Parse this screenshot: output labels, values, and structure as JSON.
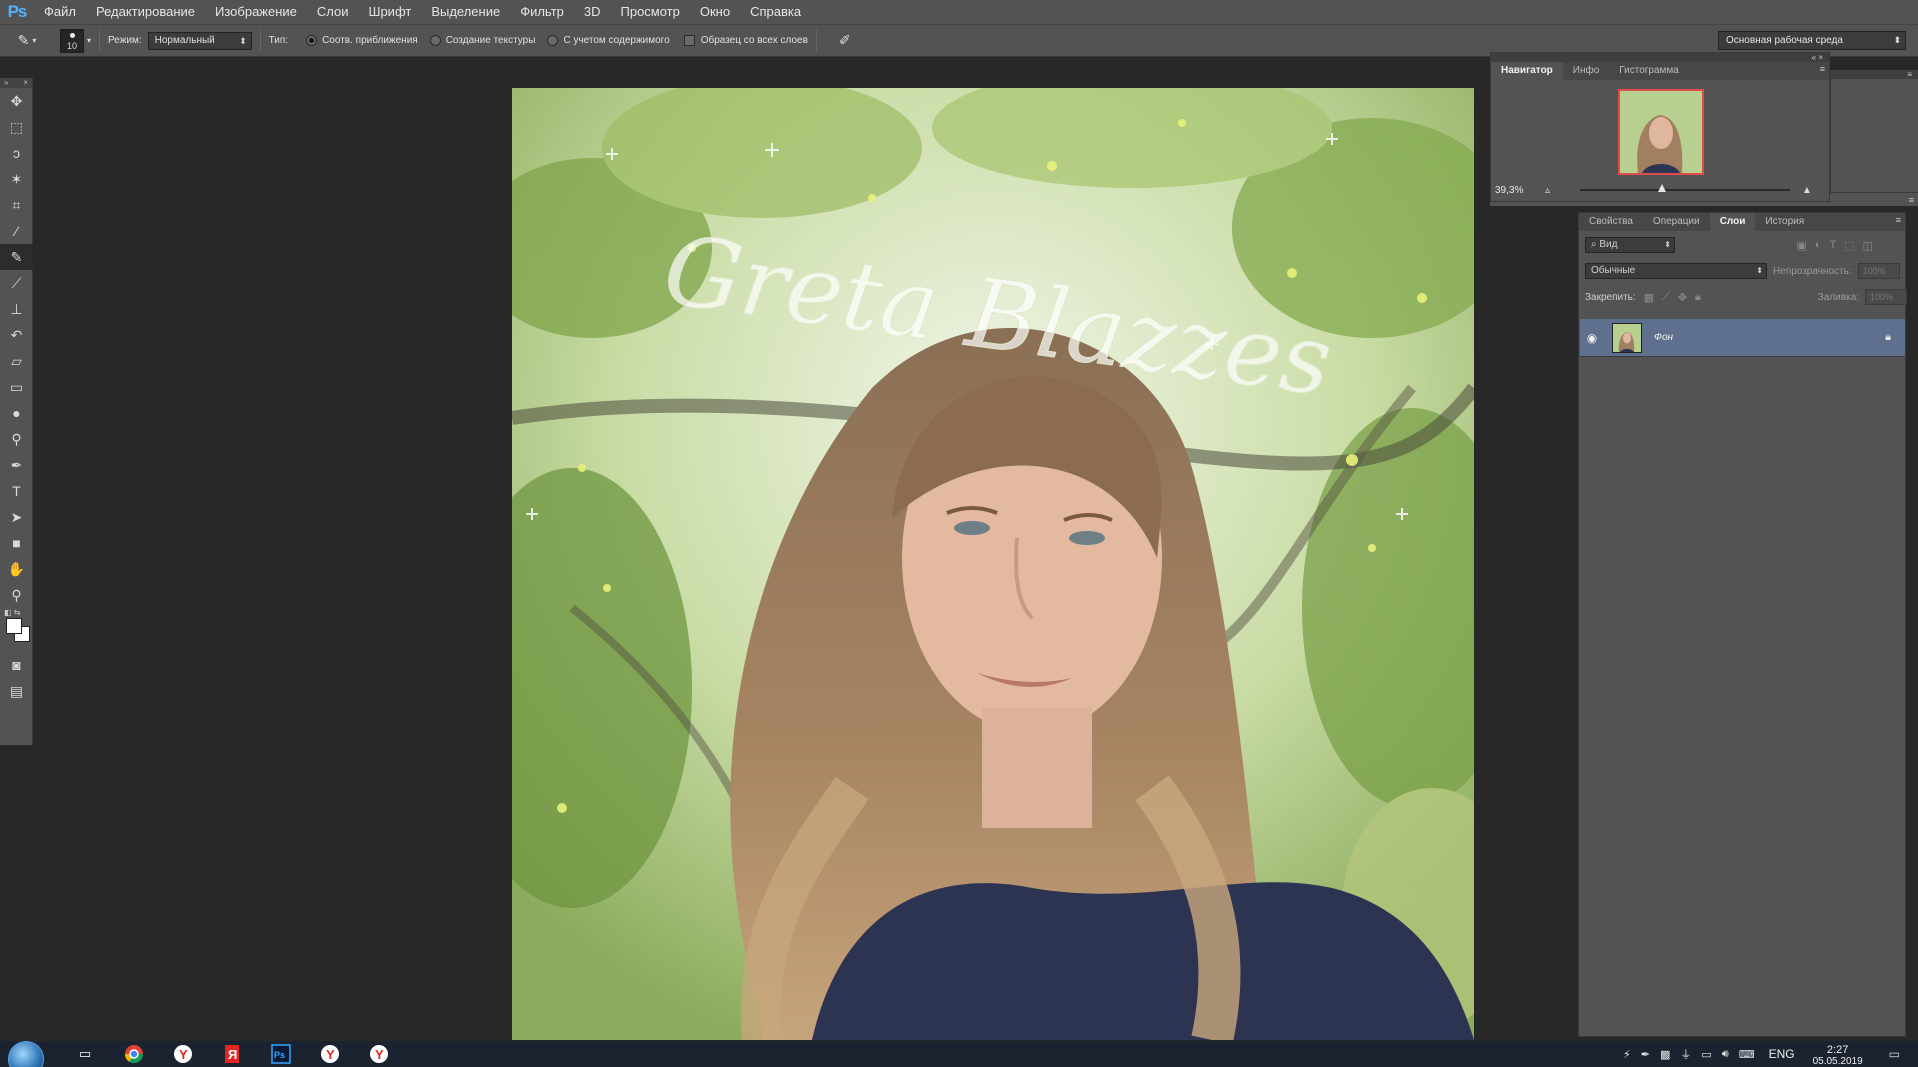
{
  "app": {
    "logo": "Ps"
  },
  "menu": [
    "Файл",
    "Редактирование",
    "Изображение",
    "Слои",
    "Шрифт",
    "Выделение",
    "Фильтр",
    "3D",
    "Просмотр",
    "Окно",
    "Справка"
  ],
  "options": {
    "brush_size": "10",
    "mode_label": "Режим:",
    "mode_value": "Нормальный",
    "type_label": "Тип:",
    "type_options": [
      "Соотв. приближения",
      "Создание текстуры",
      "С учетом содержимого"
    ],
    "sample_all_label": "Образец со всех слоев",
    "workspace": "Основная рабочая среда"
  },
  "document": {
    "watermark": "Greta Blazzes"
  },
  "navigator": {
    "tabs": [
      "Навигатор",
      "Инфо",
      "Гистограмма"
    ],
    "zoom": "39,3%",
    "zoom_fraction": 0.39
  },
  "layers_panel": {
    "tabs": [
      "Свойства",
      "Операции",
      "Слои",
      "История"
    ],
    "filter_label": "Вид",
    "blend_mode": "Обычные",
    "opacity_label": "Непрозрачность:",
    "opacity_value": "100%",
    "lock_label": "Закрепить:",
    "fill_label": "Заливка:",
    "fill_value": "100%",
    "layer_name": "Фон"
  },
  "taskbar": {
    "apps": [
      "explorer",
      "chrome",
      "yandex",
      "yandex-browser",
      "Ps",
      "yandex-2",
      "yandex-3"
    ],
    "lang": "ENG",
    "time": "2:27",
    "date": "05.05.2019"
  }
}
